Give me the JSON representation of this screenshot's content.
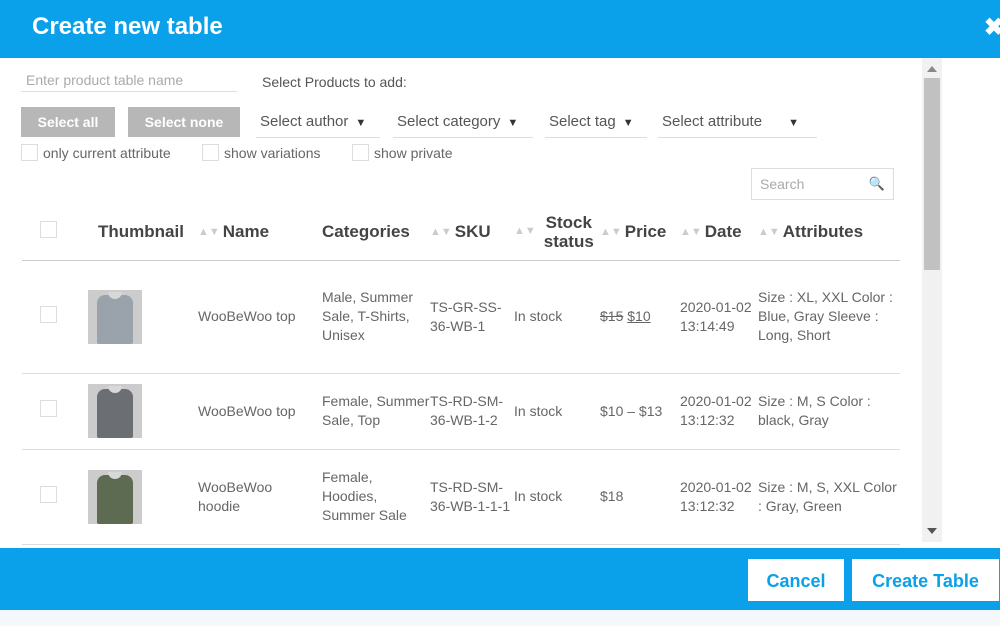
{
  "dialog": {
    "title": "Create new table",
    "close_glyph": "✖"
  },
  "form": {
    "name_placeholder": "Enter product table name",
    "select_products_label": "Select Products to add:",
    "select_all": "Select all",
    "select_none": "Select none",
    "filters": [
      "Select author",
      "Select category",
      "Select tag",
      "Select attribute"
    ],
    "checkboxes": [
      "only current attribute",
      "show variations",
      "show private"
    ],
    "search_placeholder": "Search"
  },
  "table": {
    "headers": [
      "Thumbnail",
      "Name",
      "Categories",
      "SKU",
      "Stock status",
      "Price",
      "Date",
      "Attributes"
    ],
    "rows": [
      {
        "name": "WooBeWoo top",
        "categories": "Male, Summer Sale, T-Shirts, Unisex",
        "sku": "TS-GR-SS-36-WB-1",
        "stock": "In stock",
        "price_old": "$15",
        "price_new": "$10",
        "date": "2020-01-02 13:14:49",
        "attributes": "Size : XL, XXL Color : Blue, Gray Sleeve : Long, Short",
        "shirt_color": "#9aa3ab"
      },
      {
        "name": "WooBeWoo top",
        "categories": "Female, Summer Sale, Top",
        "sku": "TS-RD-SM-36-WB-1-2",
        "stock": "In stock",
        "price": "$10 – $13",
        "date": "2020-01-02 13:12:32",
        "attributes": "Size : M, S Color : black, Gray",
        "shirt_color": "#6b6e73"
      },
      {
        "name": "WooBeWoo hoodie",
        "categories": "Female, Hoodies, Summer Sale",
        "sku": "TS-RD-SM-36-WB-1-1-1",
        "stock": "In stock",
        "price": "$18",
        "date": "2020-01-02 13:12:32",
        "attributes": "Size : M, S, XXL Color : Gray, Green",
        "shirt_color": "#5d6b52"
      }
    ]
  },
  "footer": {
    "cancel": "Cancel",
    "create": "Create Table"
  },
  "colors": {
    "accent": "#0aa0ea",
    "link": "#1a9ee0",
    "grey_button": "#b7b7b7"
  }
}
